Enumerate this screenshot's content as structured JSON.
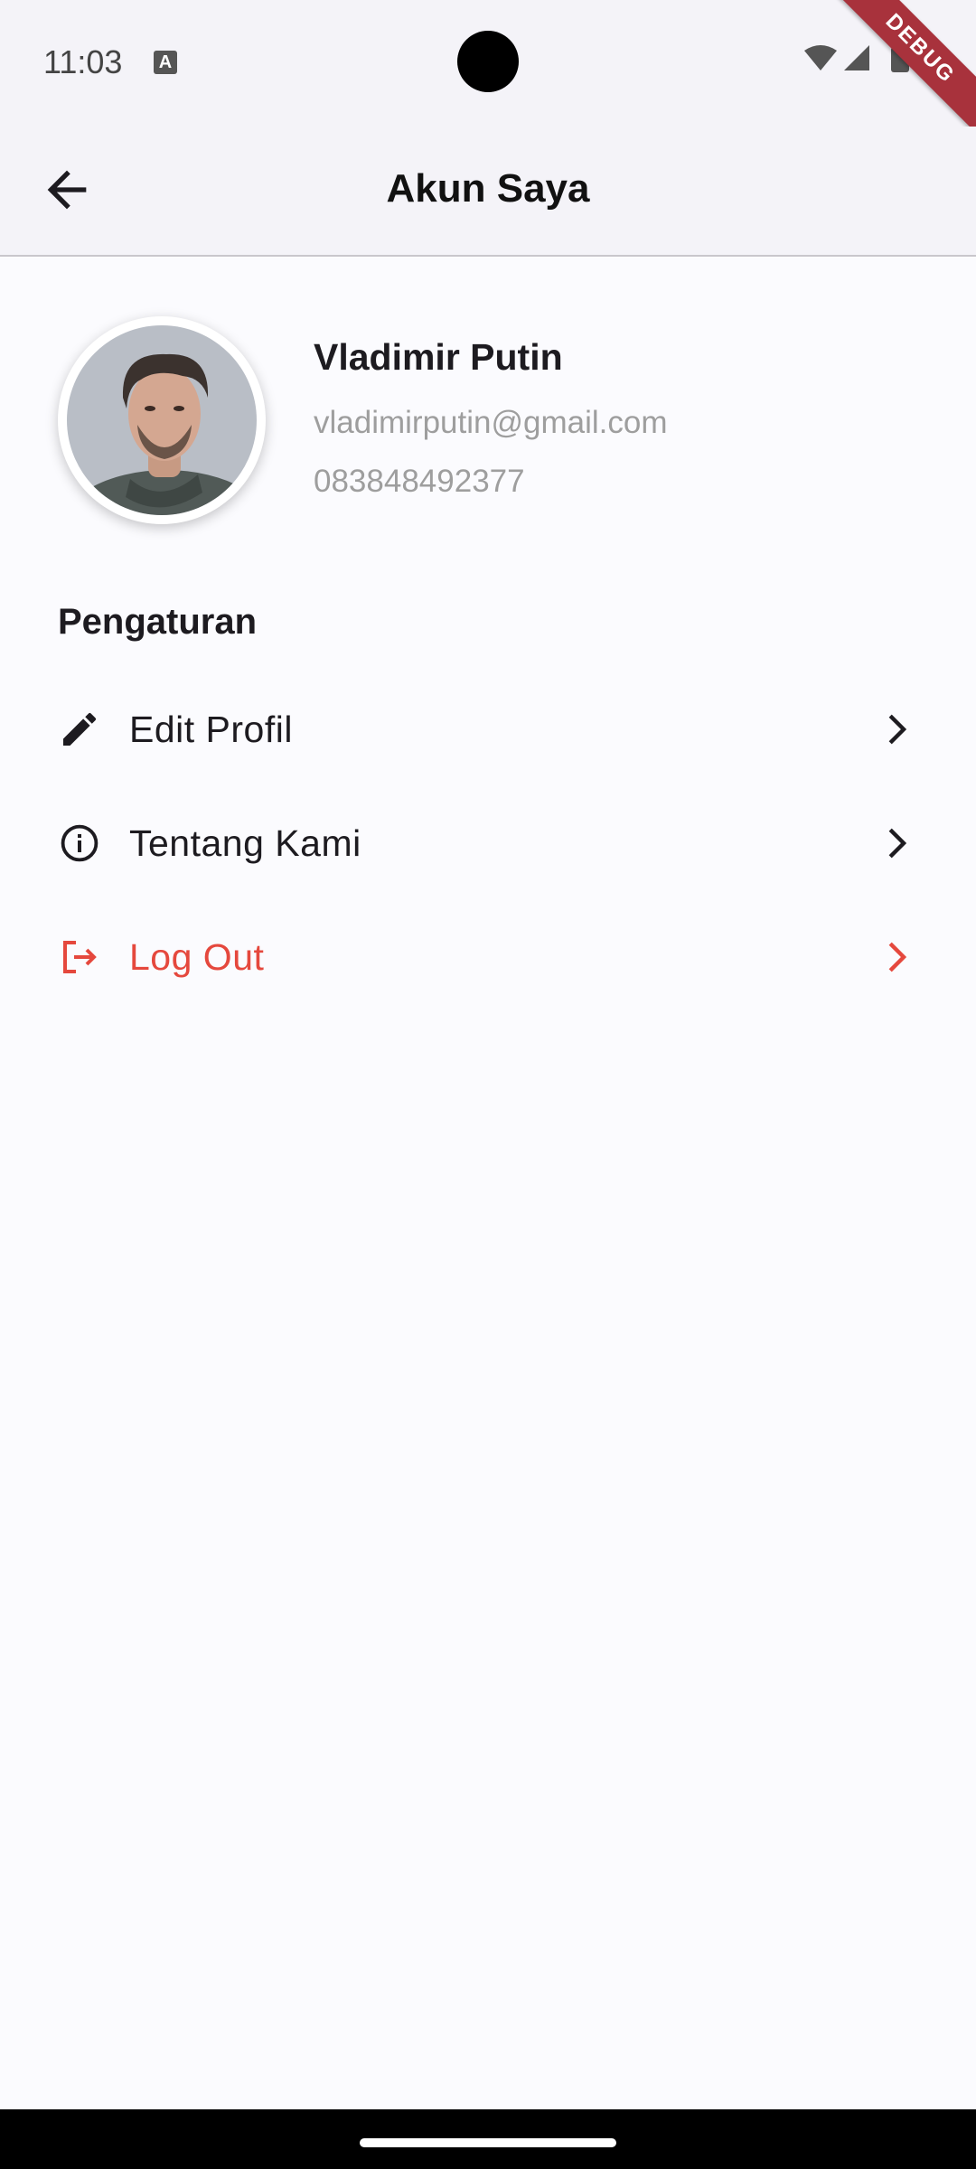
{
  "status_bar": {
    "time": "11:03",
    "debug_label": "DEBUG"
  },
  "app_bar": {
    "title": "Akun Saya",
    "back_icon": "arrow-back-icon"
  },
  "profile": {
    "name": "Vladimir Putin",
    "email": "vladimirputin@gmail.com",
    "phone": "083848492377"
  },
  "settings": {
    "title": "Pengaturan",
    "items": [
      {
        "label": "Edit Profil",
        "icon": "pencil-icon"
      },
      {
        "label": "Tentang Kami",
        "icon": "info-icon"
      },
      {
        "label": "Log Out",
        "icon": "logout-icon"
      }
    ]
  },
  "colors": {
    "danger": "#e5483d",
    "background": "#fbfbfe",
    "app_bar": "#f4f3f8",
    "secondary_text": "#9e9e9e"
  }
}
